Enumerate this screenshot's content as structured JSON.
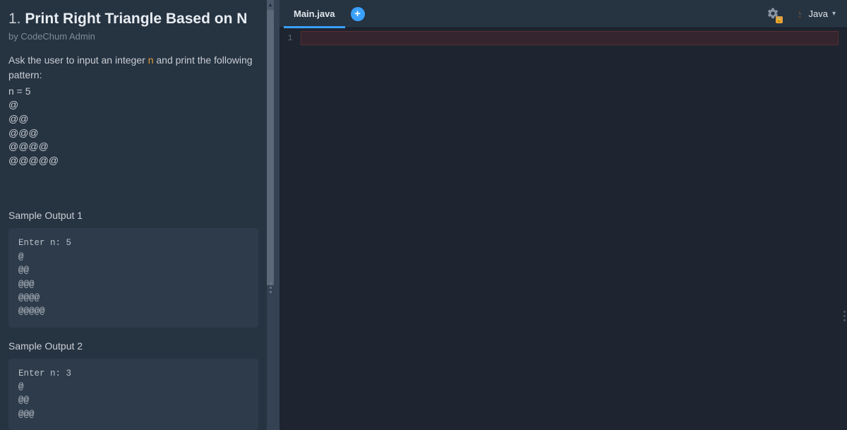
{
  "problem": {
    "number": "1.",
    "title": "Print Right Triangle Based on N",
    "author": "by CodeChum Admin",
    "description_before": "Ask the user to input an integer ",
    "description_hl": "n",
    "description_after": " and print the following pattern:",
    "pattern": "n = 5\n@\n@@\n@@@\n@@@@\n@@@@@"
  },
  "samples": [
    {
      "label": "Sample Output 1",
      "text": "Enter n: 5\n@\n@@\n@@@\n@@@@\n@@@@@"
    },
    {
      "label": "Sample Output 2",
      "text": "Enter n: 3\n@\n@@\n@@@"
    }
  ],
  "editor": {
    "tab_label": "Main.java",
    "language": "Java",
    "line_number": "1"
  }
}
